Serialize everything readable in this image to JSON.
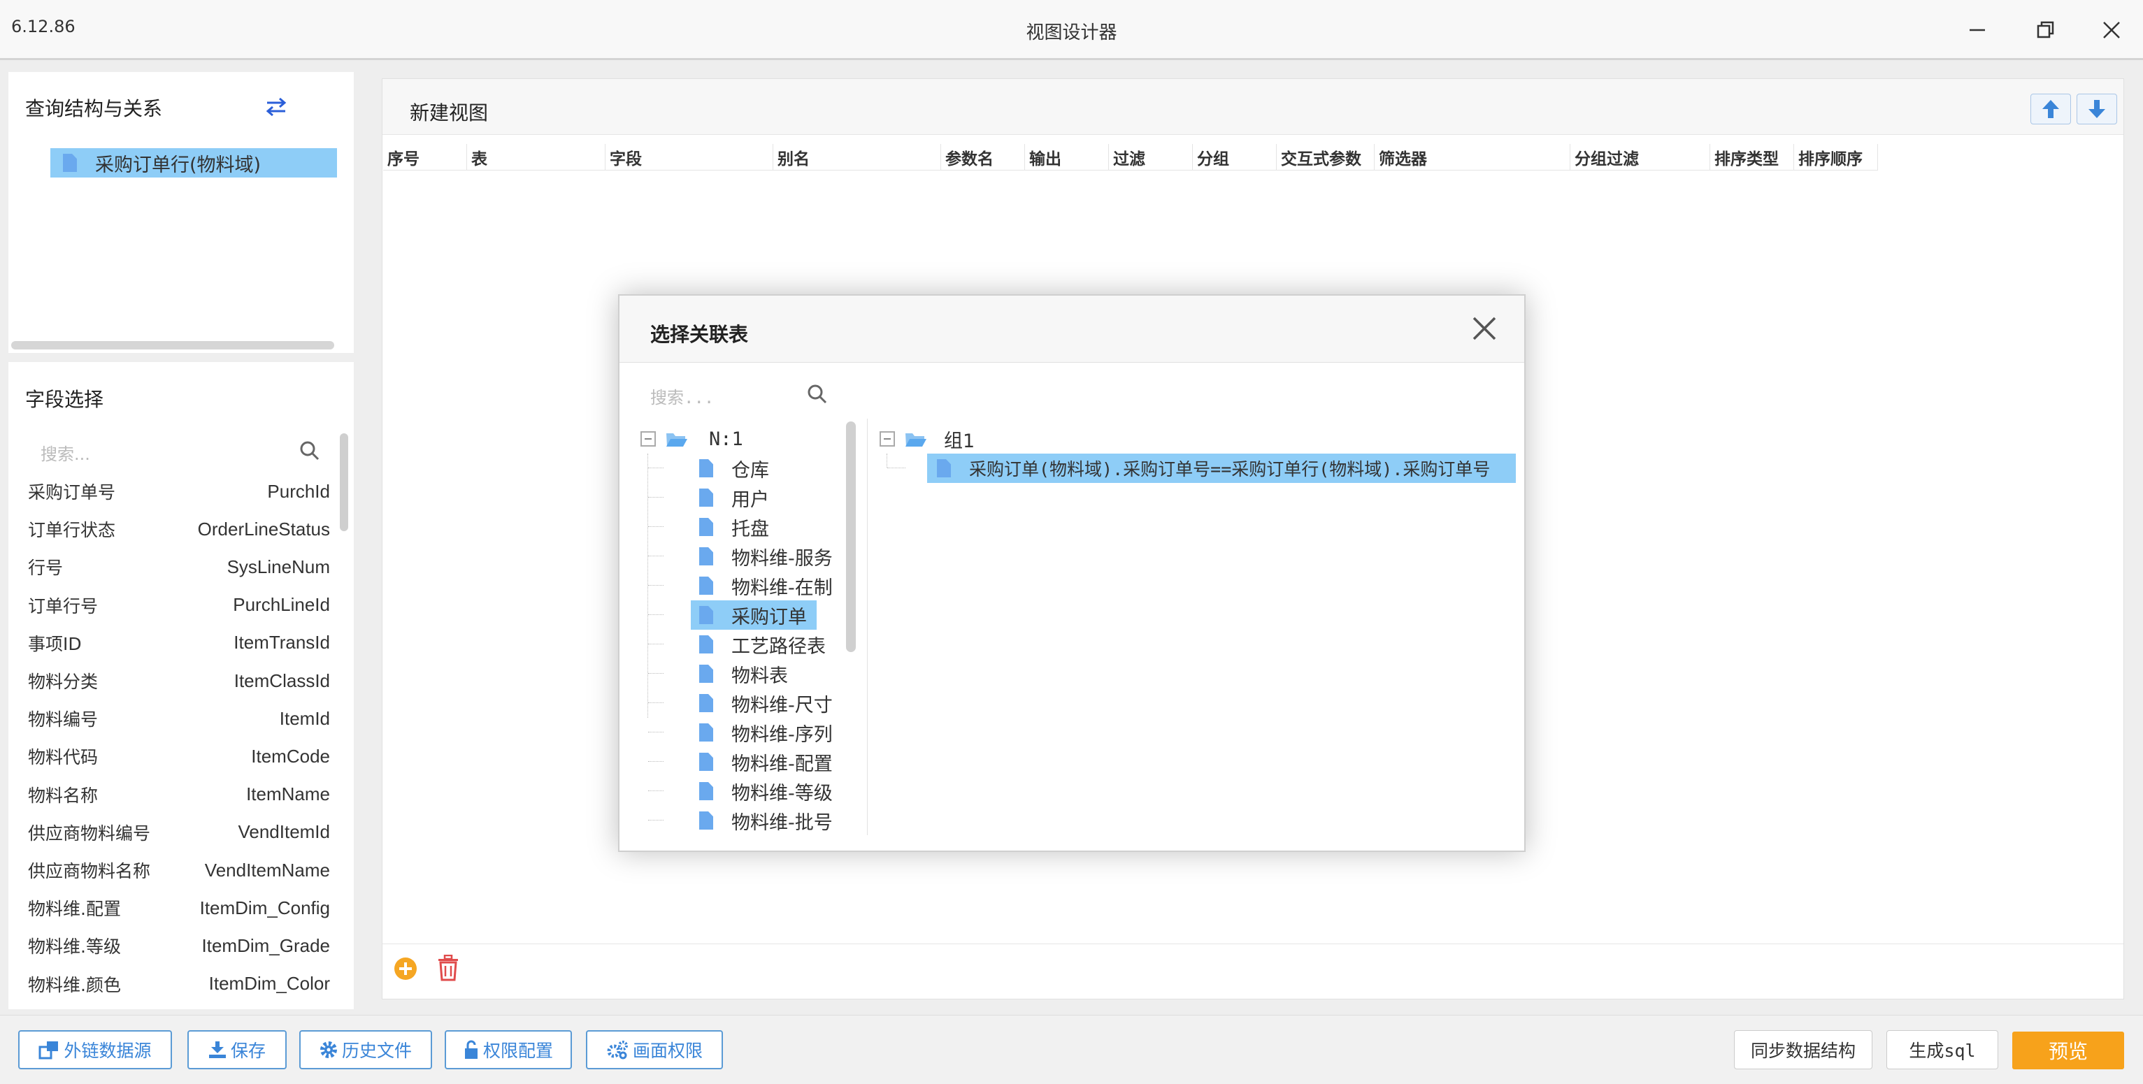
{
  "window": {
    "version": "6.12.86",
    "title": "视图设计器"
  },
  "left_top": {
    "title": "查询结构与关系",
    "swap_icon": "swap-arrows-icon",
    "tree_root": "采购订单行(物料域)"
  },
  "fields": {
    "title": "字段选择",
    "search_placeholder": "搜索...",
    "items": [
      {
        "cn": "采购订单号",
        "en": "PurchId"
      },
      {
        "cn": "订单行状态",
        "en": "OrderLineStatus"
      },
      {
        "cn": "行号",
        "en": "SysLineNum"
      },
      {
        "cn": "订单行号",
        "en": "PurchLineId"
      },
      {
        "cn": "事项ID",
        "en": "ItemTransId"
      },
      {
        "cn": "物料分类",
        "en": "ItemClassId"
      },
      {
        "cn": "物料编号",
        "en": "ItemId"
      },
      {
        "cn": "物料代码",
        "en": "ItemCode"
      },
      {
        "cn": "物料名称",
        "en": "ItemName"
      },
      {
        "cn": "供应商物料编号",
        "en": "VendItemId"
      },
      {
        "cn": "供应商物料名称",
        "en": "VendItemName"
      },
      {
        "cn": "物料维.配置",
        "en": "ItemDim_Config"
      },
      {
        "cn": "物料维.等级",
        "en": "ItemDim_Grade"
      },
      {
        "cn": "物料维.颜色",
        "en": "ItemDim_Color"
      }
    ]
  },
  "main": {
    "title": "新建视图",
    "columns": [
      "序号",
      "表",
      "字段",
      "别名",
      "参数名",
      "输出",
      "过滤",
      "分组",
      "交互式参数",
      "筛选器",
      "分组过滤",
      "排序类型",
      "排序顺序"
    ]
  },
  "dialog": {
    "title": "选择关联表",
    "search_placeholder": "搜索...",
    "left_root": "N:1",
    "left_items": [
      "仓库",
      "用户",
      "托盘",
      "物料维-服务",
      "物料维-在制",
      "采购订单",
      "工艺路径表",
      "物料表",
      "物料维-尺寸",
      "物料维-序列",
      "物料维-配置",
      "物料维-等级",
      "物料维-批号"
    ],
    "left_selected_index": 5,
    "right_root": "组1",
    "right_items": [
      "采购订单(物料域).采购订单号==采购订单行(物料域).采购订单号"
    ]
  },
  "toolbar": {
    "buttons": [
      "外链数据源",
      "保存",
      "历史文件",
      "权限配置",
      "画面权限"
    ],
    "sync": "同步数据结构",
    "gen_sql": "生成sql",
    "preview": "预览"
  },
  "colors": {
    "accent": "#3a85d8",
    "selection": "#8ecdf7",
    "preview": "#f7a21b",
    "add": "#f5a623",
    "delete": "#e04b4b"
  }
}
